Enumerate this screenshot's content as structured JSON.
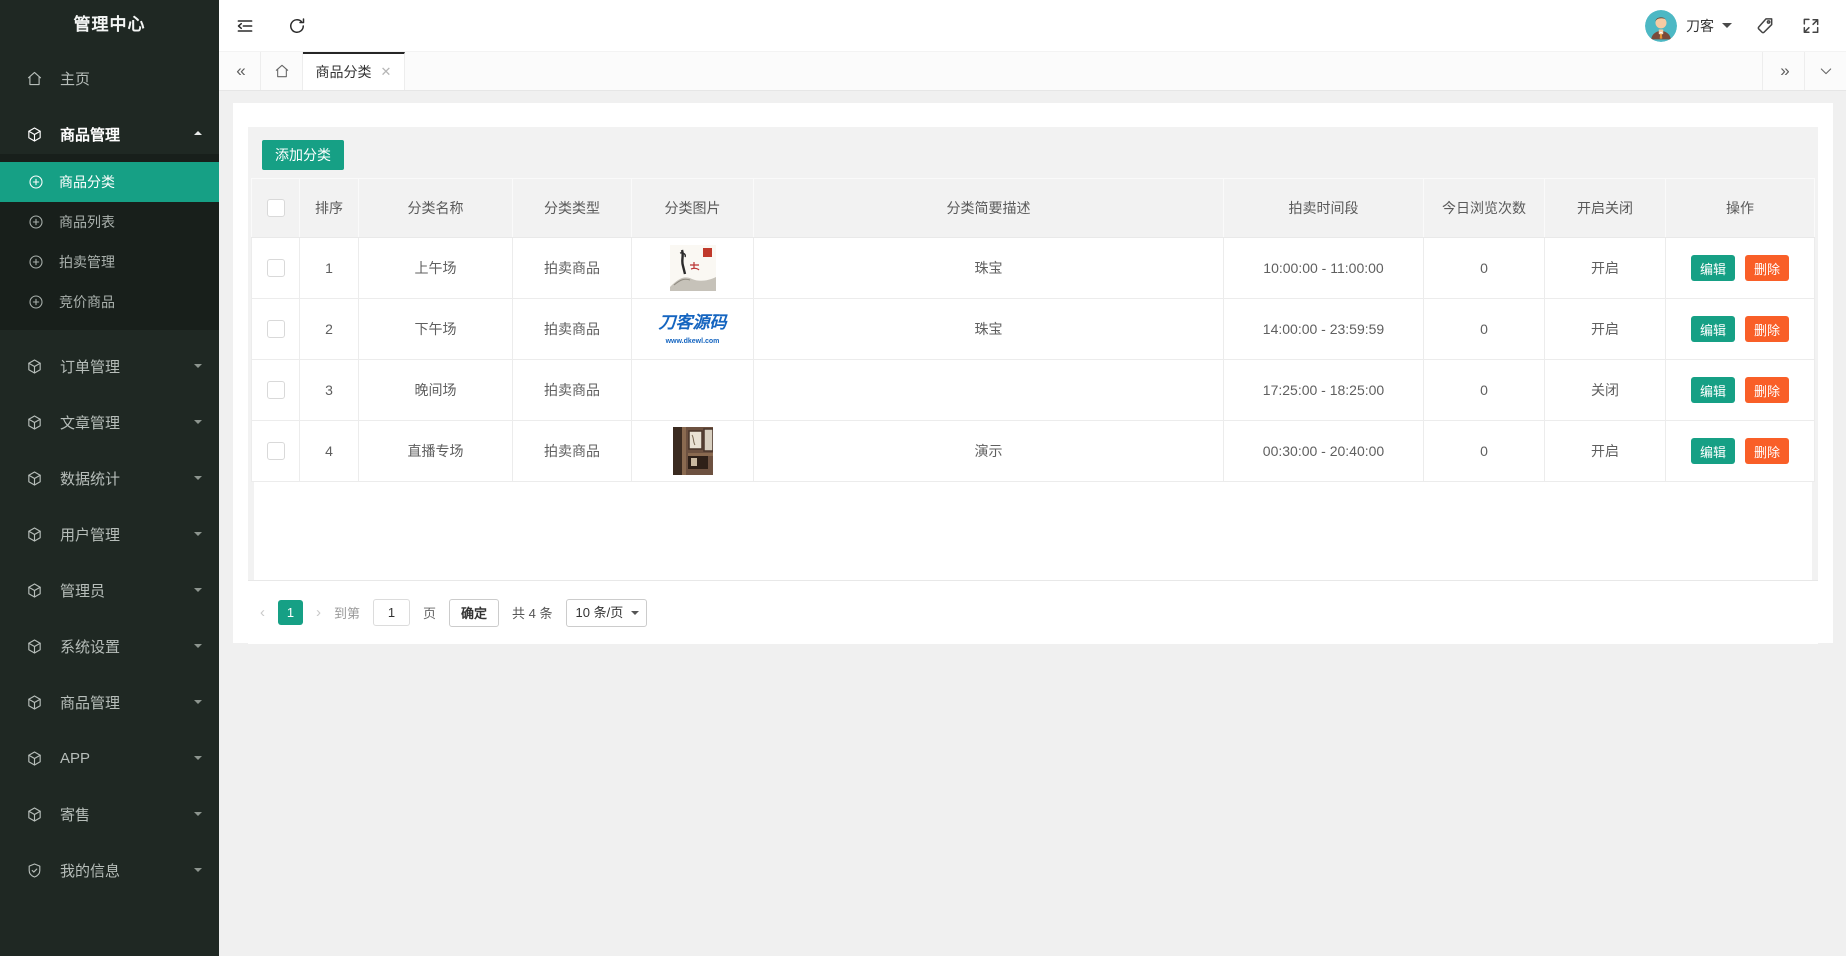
{
  "app": {
    "title": "管理中心"
  },
  "colors": {
    "accent": "#16a085",
    "danger": "#f95f28",
    "sidebar_bg": "#1f2823",
    "active_tab_border": "#262626",
    "logo_blue": "#1565c0",
    "avatar_bg": "#4db8c4"
  },
  "sidebar": {
    "title": "管理中心",
    "items": [
      {
        "label": "主页",
        "icon": "home-icon"
      },
      {
        "label": "商品管理",
        "icon": "cube-icon",
        "state": "expanded"
      },
      {
        "label": "商品分类",
        "icon": "plus-circle-icon",
        "state": "active"
      },
      {
        "label": "商品列表",
        "icon": "plus-circle-icon"
      },
      {
        "label": "拍卖管理",
        "icon": "plus-circle-icon"
      },
      {
        "label": "竞价商品",
        "icon": "plus-circle-icon"
      },
      {
        "label": "订单管理",
        "icon": "cube-icon"
      },
      {
        "label": "文章管理",
        "icon": "cube-icon"
      },
      {
        "label": "数据统计",
        "icon": "cube-icon"
      },
      {
        "label": "用户管理",
        "icon": "cube-icon"
      },
      {
        "label": "管理员",
        "icon": "cube-icon"
      },
      {
        "label": "系统设置",
        "icon": "cube-icon"
      },
      {
        "label": "商品管理",
        "icon": "cube-icon"
      },
      {
        "label": "APP",
        "icon": "cube-icon"
      },
      {
        "label": "寄售",
        "icon": "cube-icon"
      },
      {
        "label": "我的信息",
        "icon": "shield-check-icon"
      }
    ]
  },
  "header": {
    "username": "刀客",
    "icons": [
      "collapse-menu-icon",
      "refresh-icon",
      "tag-icon",
      "fullscreen-icon"
    ]
  },
  "tabbar": {
    "active_tab": "商品分类",
    "close_glyph": "✕",
    "left_controls": [
      "scroll-tabs-left",
      "home-tab"
    ],
    "right_controls": [
      "scroll-tabs-right",
      "tab-menu-dropdown"
    ]
  },
  "toolbar": {
    "add_button": "添加分类"
  },
  "table": {
    "headers": [
      "排序",
      "分类名称",
      "分类类型",
      "分类图片",
      "分类简要描述",
      "拍卖时间段",
      "今日浏览次数",
      "开启关闭",
      "操作"
    ],
    "actions": {
      "edit": "编辑",
      "delete": "删除"
    },
    "rows": [
      {
        "sort": "1",
        "name": "上午场",
        "type": "拍卖商品",
        "image": "ink-painting-thumbnail",
        "desc": "珠宝",
        "time": "10:00:00 - 11:00:00",
        "views": "0",
        "status": "开启"
      },
      {
        "sort": "2",
        "name": "下午场",
        "type": "拍卖商品",
        "image": "daoke-logo-thumbnail",
        "image_text": "刀客源码",
        "image_subtext": "www.dkewl.com",
        "desc": "珠宝",
        "time": "14:00:00 - 23:59:59",
        "views": "0",
        "status": "开启"
      },
      {
        "sort": "3",
        "name": "晚间场",
        "type": "拍卖商品",
        "image": "",
        "desc": "",
        "time": "17:25:00 - 18:25:00",
        "views": "0",
        "status": "关闭"
      },
      {
        "sort": "4",
        "name": "直播专场",
        "type": "拍卖商品",
        "image": "interior-photo-thumbnail",
        "desc": "演示",
        "time": "00:30:00 - 20:40:00",
        "views": "0",
        "status": "开启"
      }
    ]
  },
  "pagination": {
    "prev_glyph": "‹",
    "page": "1",
    "next_glyph": "›",
    "goto_label": "到第",
    "goto_value": "1",
    "page_unit": "页",
    "confirm": "确定",
    "total": "共 4 条",
    "page_size": "10 条/页"
  }
}
